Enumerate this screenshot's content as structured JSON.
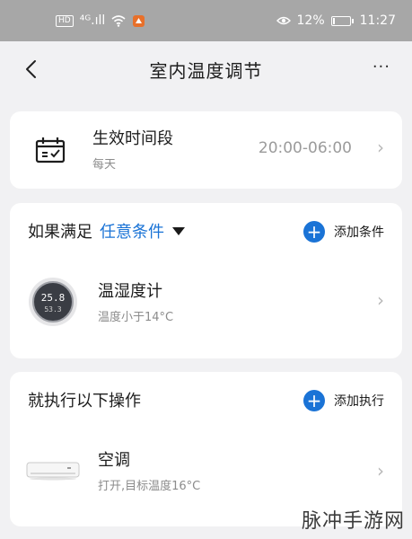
{
  "status_bar": {
    "sim_chip": "HD",
    "signal": "⁴ᴳ.ıll",
    "battery_percent": "12%",
    "battery_level": 0.12,
    "time": "11:27"
  },
  "header": {
    "title": "室内温度调节",
    "more": "···"
  },
  "schedule": {
    "title": "生效时间段",
    "repeat": "每天",
    "time_range": "20:00-06:00"
  },
  "conditions": {
    "prefix": "如果满足",
    "mode": "任意条件",
    "add_label": "添加条件",
    "device": {
      "name": "温湿度计",
      "description": "温度小于14°C",
      "display_top": "25.8",
      "display_bottom": "53.3"
    }
  },
  "actions": {
    "title": "就执行以下操作",
    "add_label": "添加执行",
    "device": {
      "name": "空调",
      "description": "打开,目标温度16°C"
    }
  },
  "watermark": "脉冲手游网",
  "colors": {
    "accent": "#1a73d6",
    "status_bar": "#a7a7a7",
    "background": "#f1f1f3"
  }
}
